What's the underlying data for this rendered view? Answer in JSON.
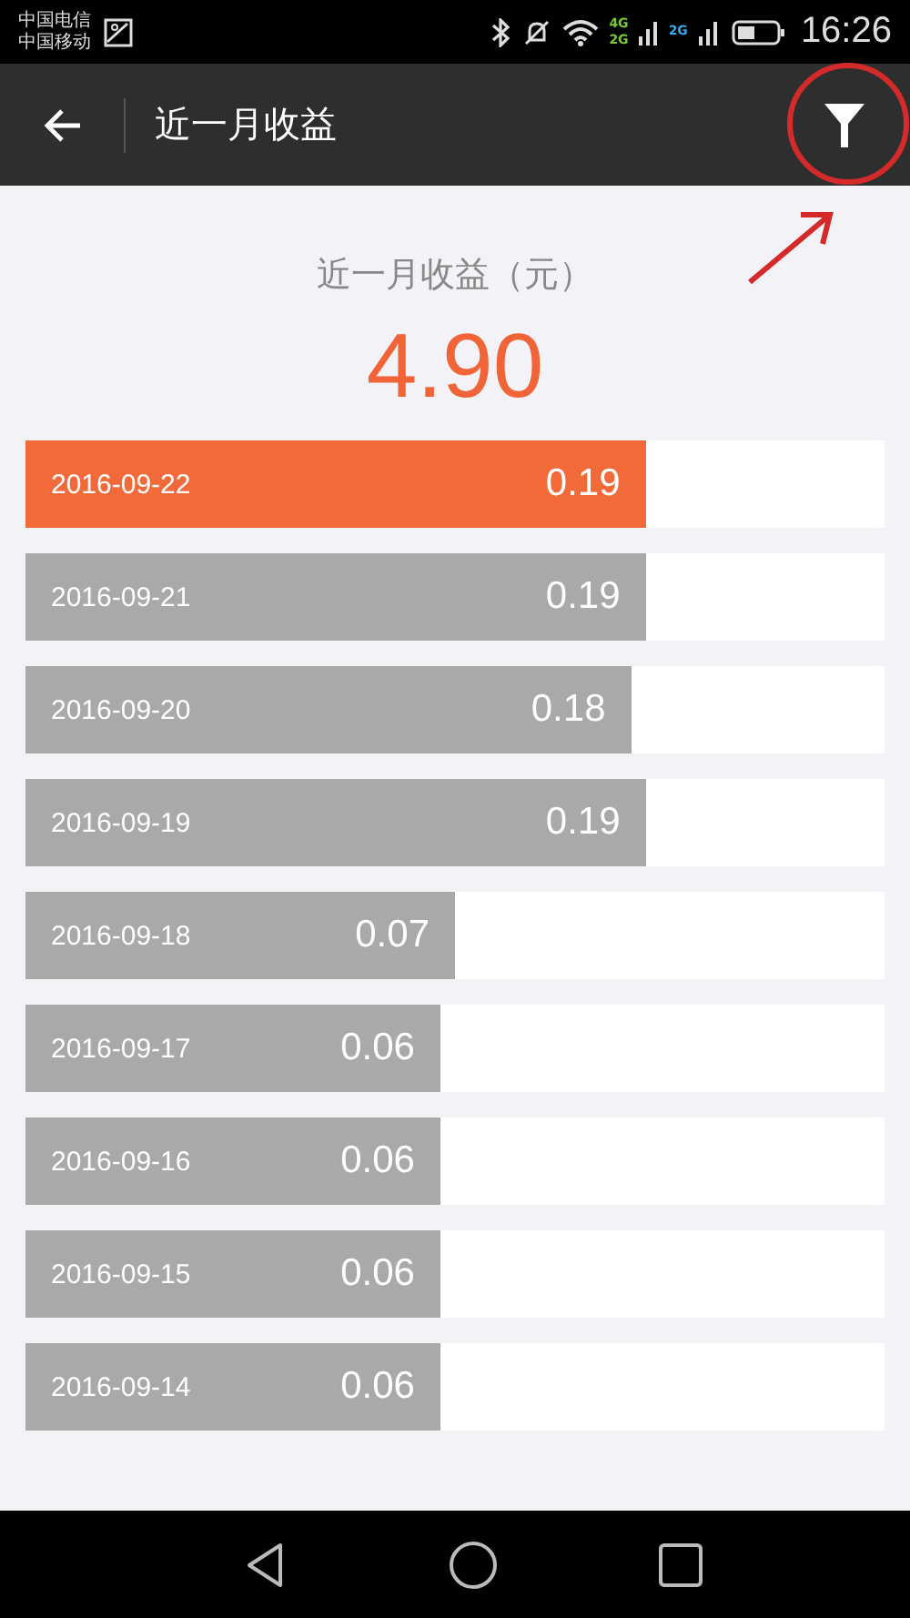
{
  "status_bar": {
    "carriers": [
      "中国电信",
      "中国移动"
    ],
    "network_labels": [
      "4G",
      "2G",
      "2G"
    ],
    "time": "16:26"
  },
  "app_bar": {
    "title": "近一月收益"
  },
  "summary": {
    "label": "近一月收益（元）",
    "amount": "4.90"
  },
  "rows": [
    {
      "date": "2016-09-22",
      "value": "0.19",
      "level": 0.722,
      "selected": true
    },
    {
      "date": "2016-09-21",
      "value": "0.19",
      "level": 0.722,
      "selected": false
    },
    {
      "date": "2016-09-20",
      "value": "0.18",
      "level": 0.705,
      "selected": false
    },
    {
      "date": "2016-09-19",
      "value": "0.19",
      "level": 0.722,
      "selected": false
    },
    {
      "date": "2016-09-18",
      "value": "0.07",
      "level": 0.5,
      "selected": false
    },
    {
      "date": "2016-09-17",
      "value": "0.06",
      "level": 0.483,
      "selected": false
    },
    {
      "date": "2016-09-16",
      "value": "0.06",
      "level": 0.483,
      "selected": false
    },
    {
      "date": "2016-09-15",
      "value": "0.06",
      "level": 0.483,
      "selected": false
    },
    {
      "date": "2016-09-14",
      "value": "0.06",
      "level": 0.483,
      "selected": false
    }
  ]
}
